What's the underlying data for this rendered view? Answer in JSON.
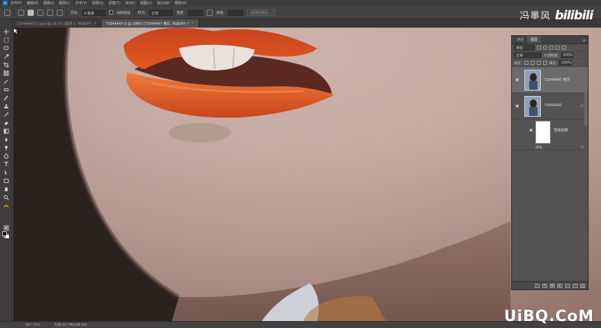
{
  "menubar": {
    "logo": "Ps",
    "items": [
      "文件(F)",
      "编辑(E)",
      "图像(I)",
      "图层(L)",
      "文字(Y)",
      "选择(S)",
      "滤镜(T)",
      "3D(D)",
      "视图(V)",
      "窗口(W)",
      "帮助(H)"
    ]
  },
  "options": {
    "feather_label": "羽化:",
    "feather_value": "0 像素",
    "antialias_label": "消除锯齿",
    "style_label": "样式:",
    "style_value": "正常",
    "width_label": "宽度:",
    "height_label": "高度:",
    "select_mask_button": "选择并遮住..."
  },
  "brand": {
    "author": "冯墨风",
    "site": "bilibili"
  },
  "tabs": [
    {
      "label": "73344447(1).psd @ 16.7% (图层 1, RGB/8*)"
    },
    {
      "label": "73344447-3 @ 298% (73344447 拷贝, RGB/8*) *"
    }
  ],
  "status": {
    "zoom": "297.72%",
    "doc": "文档:93.7M/186.6M"
  },
  "layers_panel": {
    "tab_layers": "图层",
    "tab_channels": "通道",
    "filter_kind": "类型",
    "blend_mode": "正常",
    "opacity_label": "不透明度:",
    "opacity_value": "100%",
    "lock_label": "锁定:",
    "fill_label": "填充:",
    "fill_value": "100%",
    "layers": [
      {
        "name": "73344447 拷贝",
        "selected": true
      },
      {
        "name": "73344447",
        "selected": false
      }
    ],
    "filter_mask_label": "智能滤镜",
    "filter_name": "液化"
  },
  "watermark": "UiBQ.CoM"
}
